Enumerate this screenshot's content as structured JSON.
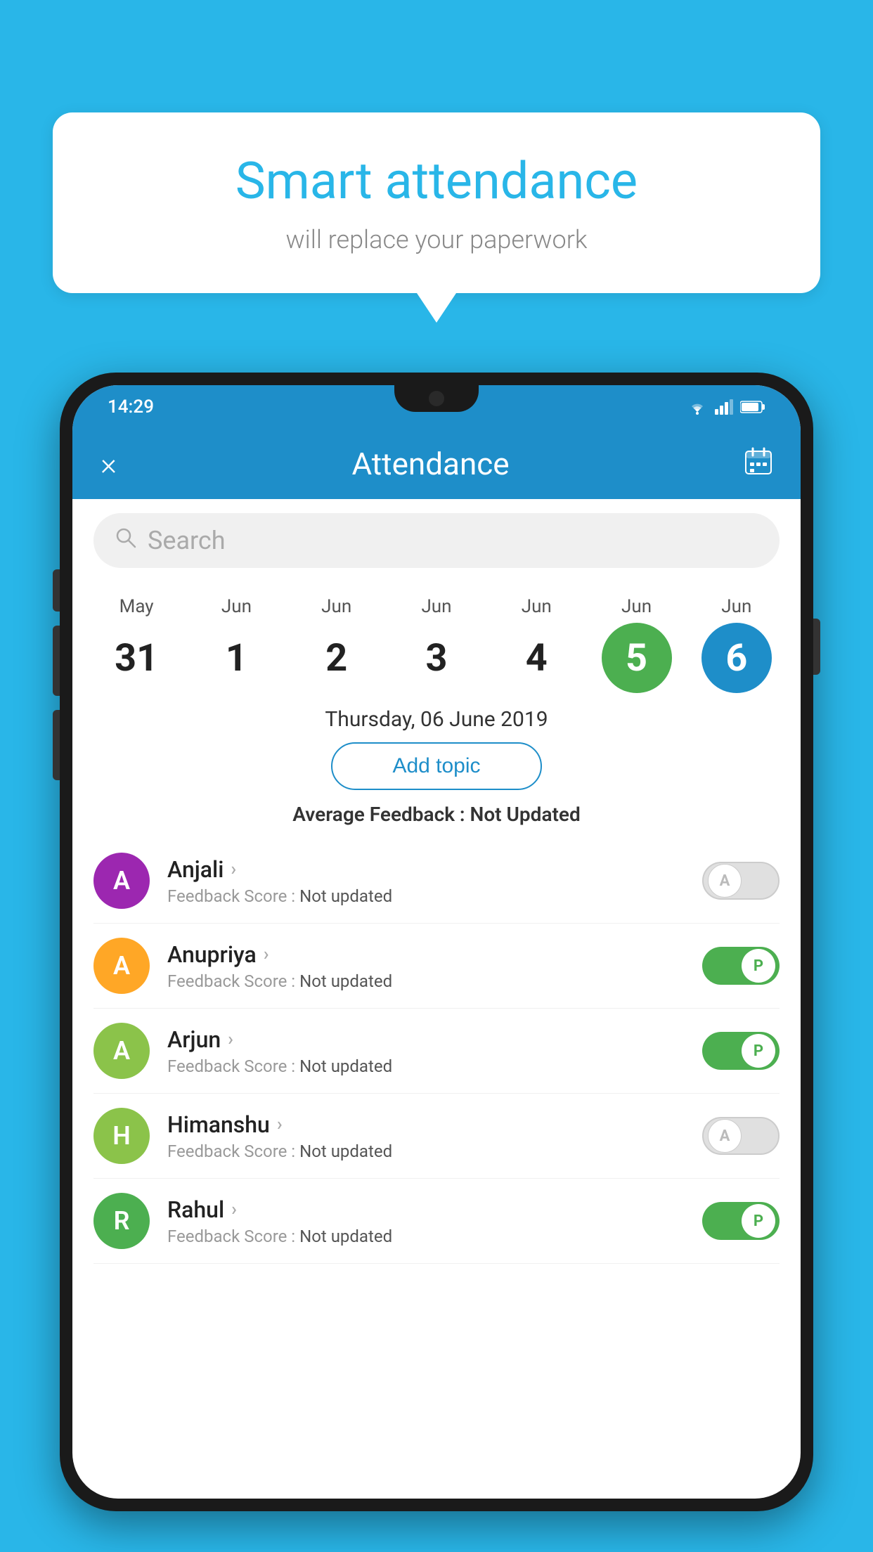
{
  "background_color": "#29b6e8",
  "bubble": {
    "title": "Smart attendance",
    "subtitle": "will replace your paperwork"
  },
  "status_bar": {
    "time": "14:29",
    "icons": [
      "wifi",
      "signal",
      "battery"
    ]
  },
  "header": {
    "title": "Attendance",
    "close_label": "×",
    "calendar_icon": "📅"
  },
  "search": {
    "placeholder": "Search"
  },
  "calendar": {
    "days": [
      {
        "month": "May",
        "date": "31",
        "state": "normal"
      },
      {
        "month": "Jun",
        "date": "1",
        "state": "normal"
      },
      {
        "month": "Jun",
        "date": "2",
        "state": "normal"
      },
      {
        "month": "Jun",
        "date": "3",
        "state": "normal"
      },
      {
        "month": "Jun",
        "date": "4",
        "state": "normal"
      },
      {
        "month": "Jun",
        "date": "5",
        "state": "today"
      },
      {
        "month": "Jun",
        "date": "6",
        "state": "selected"
      }
    ],
    "selected_date_label": "Thursday, 06 June 2019"
  },
  "add_topic_label": "Add topic",
  "average_feedback": {
    "label": "Average Feedback :",
    "value": "Not Updated"
  },
  "students": [
    {
      "name": "Anjali",
      "avatar_letter": "A",
      "avatar_color": "#9c27b0",
      "feedback_label": "Feedback Score :",
      "feedback_value": "Not updated",
      "toggle_state": "off",
      "toggle_letter": "A"
    },
    {
      "name": "Anupriya",
      "avatar_letter": "A",
      "avatar_color": "#ffa726",
      "feedback_label": "Feedback Score :",
      "feedback_value": "Not updated",
      "toggle_state": "on",
      "toggle_letter": "P"
    },
    {
      "name": "Arjun",
      "avatar_letter": "A",
      "avatar_color": "#8bc34a",
      "feedback_label": "Feedback Score :",
      "feedback_value": "Not updated",
      "toggle_state": "on",
      "toggle_letter": "P"
    },
    {
      "name": "Himanshu",
      "avatar_letter": "H",
      "avatar_color": "#8bc34a",
      "feedback_label": "Feedback Score :",
      "feedback_value": "Not updated",
      "toggle_state": "off",
      "toggle_letter": "A"
    },
    {
      "name": "Rahul",
      "avatar_letter": "R",
      "avatar_color": "#4caf50",
      "feedback_label": "Feedback Score :",
      "feedback_value": "Not updated",
      "toggle_state": "on",
      "toggle_letter": "P"
    }
  ]
}
